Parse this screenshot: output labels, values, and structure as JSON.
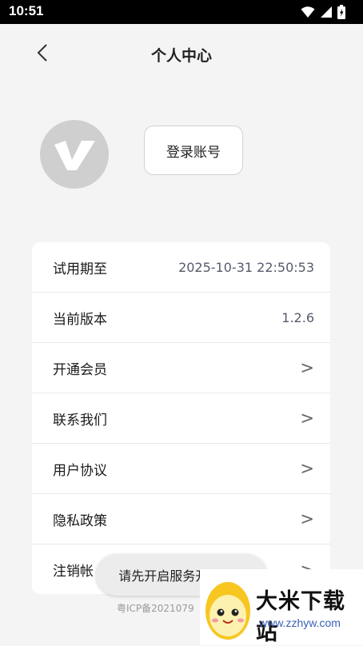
{
  "status_bar": {
    "time": "10:51"
  },
  "header": {
    "title": "个人中心"
  },
  "profile": {
    "login_label": "登录账号"
  },
  "menu": [
    {
      "label": "试用期至",
      "value": "2025-10-31 22:50:53"
    },
    {
      "label": "当前版本",
      "value": "1.2.6"
    },
    {
      "label": "开通会员",
      "chevron": ">"
    },
    {
      "label": "联系我们",
      "chevron": ">"
    },
    {
      "label": "用户协议",
      "chevron": ">"
    },
    {
      "label": "隐私政策",
      "chevron": ">"
    },
    {
      "label": "注销帐",
      "chevron": ">"
    }
  ],
  "footer": {
    "icp": "粤ICP备2021079"
  },
  "toast": {
    "message": "请先开启服务开关哦~"
  },
  "watermark": {
    "title": "大米下载站",
    "url": "www.zzhyw.com"
  },
  "colors": {
    "background": "#f4f4f4",
    "card": "#ffffff",
    "avatar": "#cfcfcf",
    "value_text": "#555b6b",
    "watermark_url": "#3a5fb3"
  },
  "icons": [
    "back-arrow-icon",
    "wifi-icon",
    "signal-icon",
    "battery-icon",
    "avatar-logo-icon",
    "mascot-icon"
  ]
}
